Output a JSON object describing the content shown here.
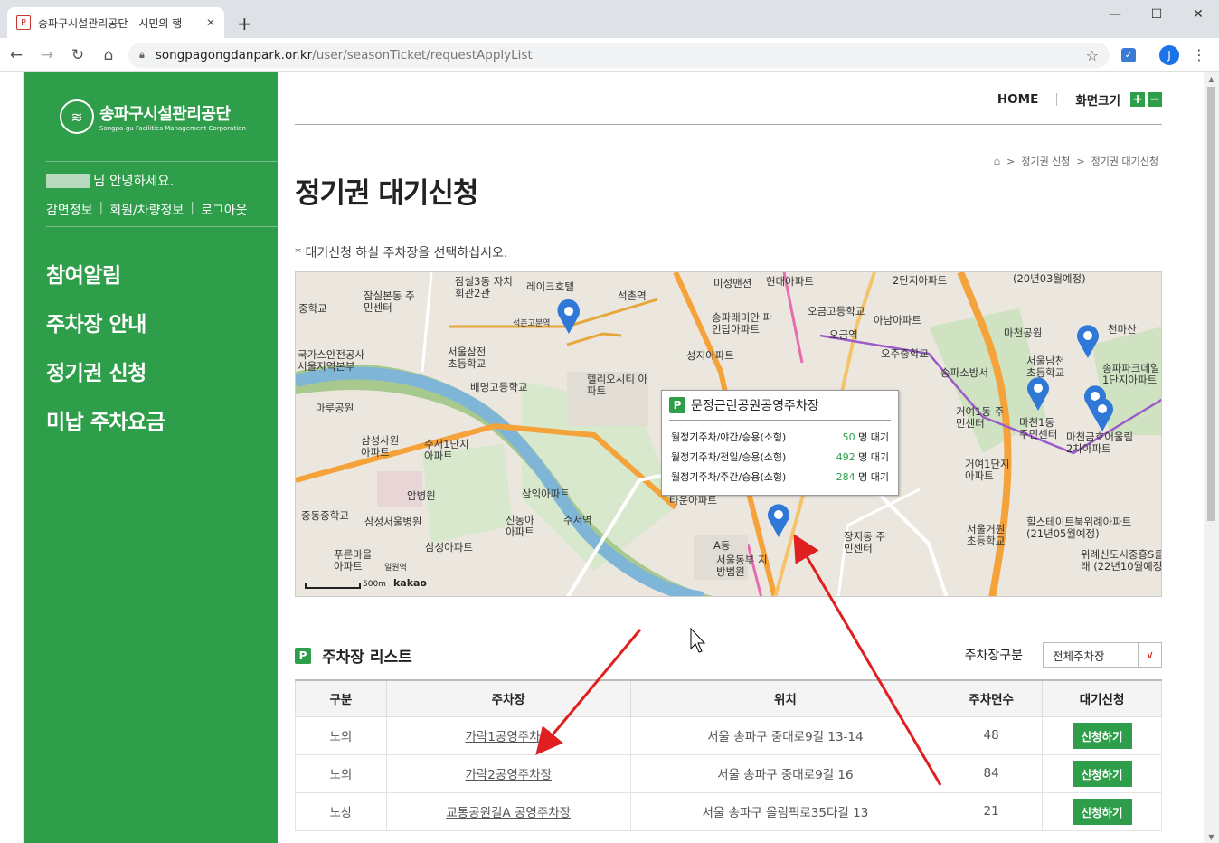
{
  "browser": {
    "tab_title": "송파구시설관리공단 - 시민의 행",
    "url_host": "songpagongdanpark.or.kr",
    "url_path": "/user/seasonTicket/requestApplyList",
    "profile_initial": "J"
  },
  "sidebar": {
    "logo_ko": "송파구시설관리공단",
    "logo_en": "Songpa-gu Facilities Management Corporation",
    "greeting": "님 안녕하세요.",
    "links": [
      "감면정보",
      "회원/차량정보",
      "로그아웃"
    ],
    "menu": [
      "참여알림",
      "주차장 안내",
      "정기권 신청",
      "미납 주차요금"
    ]
  },
  "header": {
    "home": "HOME",
    "zoom_label": "화면크기",
    "zoom_in": "+",
    "zoom_out": "−"
  },
  "breadcrumb": [
    "정기권 신청",
    "정기권 대기신청"
  ],
  "page": {
    "title": "정기권 대기신청",
    "notice": "* 대기신청 하실 주차장을 선택하십시오."
  },
  "map": {
    "labels": [
      "잠실본동 주민센터",
      "잠실3동 자치회관2관",
      "레이크호텔",
      "석촌역",
      "석촌고분역",
      "서울삼전 초등학교",
      "배명고등학교",
      "헬리오시티 아파트",
      "미성맨션",
      "현대아파트",
      "송파래미안 파인탑아파트",
      "성지아파트",
      "오금고등학교",
      "오금역",
      "아남아파트",
      "오주중학교",
      "송파소방서",
      "2단지아파트",
      "(20년03월예정)",
      "마천공원",
      "천마산",
      "서울남천 초등학교",
      "송파파크데일 1단지아파트",
      "마천1동 주민센터",
      "거여1동 주민센터",
      "마천금호어울림 2차아파트",
      "거여1단지 아파트",
      "마루공원",
      "삼성사원 아파트",
      "수서1단지 아파트",
      "암병원",
      "중동중학교",
      "삼성서울병원",
      "삼익아파트",
      "신동아 아파트",
      "수서역",
      "삼성아파트",
      "푸른마을 아파트",
      "일원역",
      "타운아파트",
      "A동",
      "서울동부 지방법원",
      "장지동 주민센터",
      "서울거원 초등학교",
      "힐스테이트북위례아파트 (21년05월예정)",
      "위례신도시중흥S클래 (22년10월예정)",
      "국가스안전공사 서울지역본부",
      "중학교"
    ],
    "scale": "500m",
    "provider": "kakao"
  },
  "popup": {
    "title": "문정근린공원공영주차장",
    "rows": [
      {
        "type": "월정기주차/야간/승용(소형)",
        "count": "50",
        "unit": "명 대기"
      },
      {
        "type": "월정기주차/전일/승용(소형)",
        "count": "492",
        "unit": "명 대기"
      },
      {
        "type": "월정기주차/주간/승용(소형)",
        "count": "284",
        "unit": "명 대기"
      }
    ]
  },
  "list": {
    "title": "주차장 리스트",
    "filter_label": "주차장구분",
    "filter_value": "전체주차장",
    "columns": [
      "구분",
      "주차장",
      "위치",
      "주차면수",
      "대기신청"
    ],
    "rows": [
      {
        "kind": "노외",
        "name": "가락1공영주차장",
        "location": "서울 송파구 중대로9길 13-14",
        "spaces": "48",
        "action": "신청하기"
      },
      {
        "kind": "노외",
        "name": "가락2공영주차장",
        "location": "서울 송파구 중대로9길 16",
        "spaces": "84",
        "action": "신청하기"
      },
      {
        "kind": "노상",
        "name": "교통공원길A 공영주차장",
        "location": "서울 송파구 올림픽로35다길 13",
        "spaces": "21",
        "action": "신청하기"
      }
    ]
  },
  "colors": {
    "brand_green": "#2f9e4a",
    "annotation_red": "#e02020"
  }
}
